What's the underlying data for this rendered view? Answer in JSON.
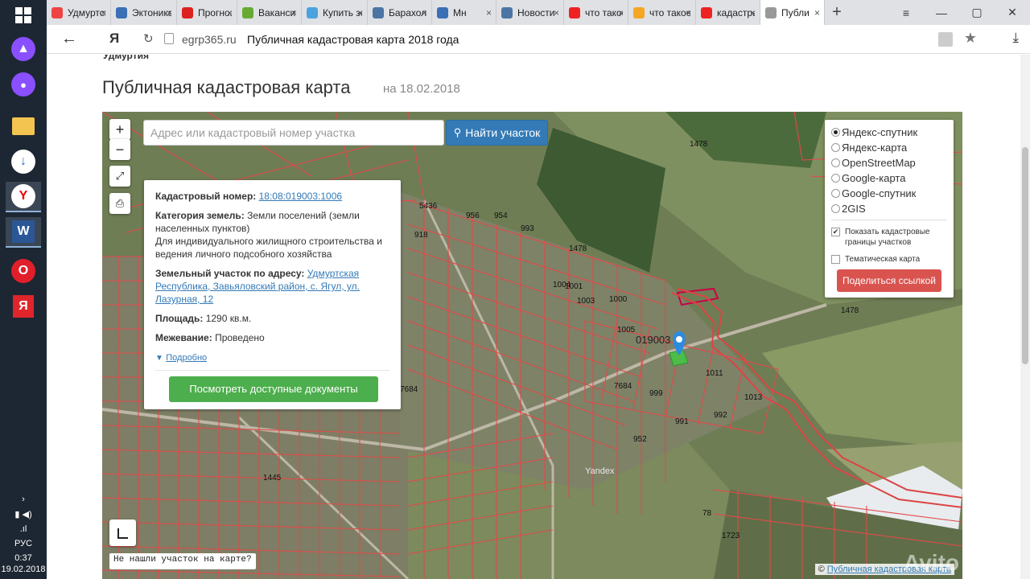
{
  "taskbar": {
    "icons": [
      "windows-start-icon",
      "alice-assistant-icon",
      "voice-icon",
      "explorer-icon",
      "download-icon",
      "yandex-browser-icon",
      "word-icon",
      "opera-icon",
      "yandex-icon"
    ],
    "lang": "РУС",
    "time": "0:37",
    "date": "19.02.2018"
  },
  "tabs": [
    {
      "title": "Удмуртск",
      "fav_color": "#e44",
      "icon": "avito-favicon"
    },
    {
      "title": "Эктоника",
      "fav_color": "#3b6fb6",
      "icon": "pause-favicon"
    },
    {
      "title": "Прогноз",
      "fav_color": "#d22",
      "icon": "weather-favicon"
    },
    {
      "title": "Вакансии",
      "fav_color": "#6a3",
      "icon": "jobs-favicon"
    },
    {
      "title": "Купить зе",
      "fav_color": "#4aa3df",
      "icon": "buy-favicon"
    },
    {
      "title": "Барахолка",
      "fav_color": "#4c75a3",
      "icon": "vk-favicon"
    },
    {
      "title": "Мн",
      "fav_color": "#3b6fb6",
      "icon": "video-favicon"
    },
    {
      "title": "Новости",
      "fav_color": "#4c75a3",
      "icon": "vk-favicon"
    },
    {
      "title": "что такое",
      "fav_color": "#e22",
      "icon": "yandex-favicon"
    },
    {
      "title": "что такое",
      "fav_color": "#f5a623",
      "icon": "image-favicon"
    },
    {
      "title": "кадастра",
      "fav_color": "#e22",
      "icon": "yandex-favicon"
    },
    {
      "title": "Публи",
      "fav_color": "#999",
      "icon": "page-favicon",
      "active": true
    }
  ],
  "addressbar": {
    "domain": "egrp365.ru",
    "page_title": "Публичная кадастровая карта 2018 года"
  },
  "page": {
    "breadcrumb_region": "Удмуртия",
    "title": "Публичная кадастровая карта",
    "date": "на 18.02.2018"
  },
  "map": {
    "zoom_in": "+",
    "zoom_out": "−",
    "search_placeholder": "Адрес или кадастровый номер участка",
    "search_button": "Найти участок",
    "not_found": "Не нашли участок на карте?",
    "copyright_link": "Публичная кадастровая карта",
    "copyright_prefix": "©",
    "watermark": "Avito",
    "parcel_labels": [
      "1478",
      "1478",
      "1478",
      "5436",
      "954",
      "956",
      "993",
      "918",
      "1000",
      "1001",
      "1003",
      "1004",
      "1005",
      "019003",
      "7684",
      "7684",
      "991",
      "992",
      "952",
      "999",
      "1011",
      "1013",
      "1445",
      "78",
      "1723",
      "Yandex"
    ]
  },
  "info": {
    "cad_label": "Кадастровый номер:",
    "cad_value": "18:08:019003:1006",
    "category_label": "Категория земель:",
    "category_value": "Земли поселений (земли населенных пунктов)",
    "usage": "Для индивидуального жилищного строительства и ведения личного подсобного хозяйства",
    "address_label": "Земельный участок по адресу:",
    "address_value": "Удмуртская Республика, Завьяловский район, с. Ягул, ул. Лазурная, 12",
    "area_label": "Площадь:",
    "area_value": "1290 кв.м.",
    "survey_label": "Межевание:",
    "survey_value": "Проведено",
    "more_toggle": "Подробно",
    "docs_button": "Посмотреть доступные документы"
  },
  "layers": {
    "options": [
      {
        "label": "Яндекс-спутник",
        "selected": true
      },
      {
        "label": "Яндекс-карта",
        "selected": false
      },
      {
        "label": "OpenStreetMap",
        "selected": false
      },
      {
        "label": "Google-карта",
        "selected": false
      },
      {
        "label": "Google-спутник",
        "selected": false
      },
      {
        "label": "2GIS",
        "selected": false
      }
    ],
    "show_borders": "Показать кадастровые границы участков",
    "show_borders_checked": true,
    "thematic": "Тематическая карта",
    "thematic_checked": false,
    "share_button": "Поделиться ссылкой"
  }
}
